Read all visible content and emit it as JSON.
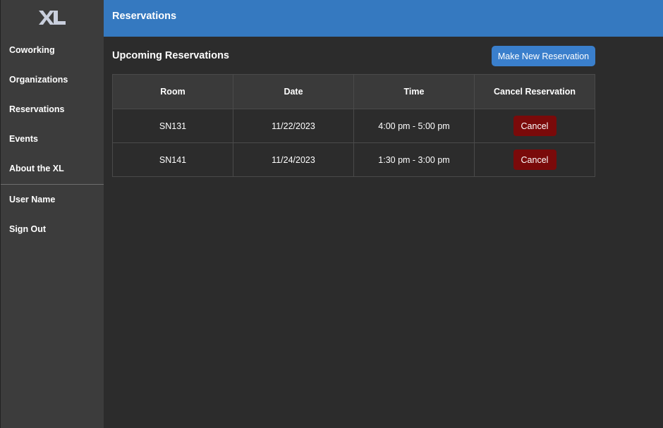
{
  "logo": {
    "text": "XL",
    "color": "#c9cfdd"
  },
  "sidebar": {
    "items": [
      {
        "label": "Coworking"
      },
      {
        "label": "Organizations"
      },
      {
        "label": "Reservations"
      },
      {
        "label": "Events"
      },
      {
        "label": "About the XL"
      }
    ],
    "user_items": [
      {
        "label": "User Name"
      },
      {
        "label": "Sign Out"
      }
    ]
  },
  "header": {
    "title": "Reservations",
    "color": "#3579c0"
  },
  "main": {
    "section_title": "Upcoming Reservations",
    "new_button_label": "Make New Reservation",
    "table": {
      "columns": [
        "Room",
        "Date",
        "Time",
        "Cancel Reservation"
      ],
      "rows": [
        {
          "room": "SN131",
          "date": "11/22/2023",
          "time": "4:00 pm - 5:00 pm",
          "action": "Cancel"
        },
        {
          "room": "SN141",
          "date": "11/24/2023",
          "time": "1:30 pm - 3:00 pm",
          "action": "Cancel"
        }
      ]
    }
  },
  "colors": {
    "accent": "#3a7fcc",
    "danger": "#7a0a0a",
    "background": "#2c2c2c",
    "sidebar": "#3c3c3c"
  }
}
